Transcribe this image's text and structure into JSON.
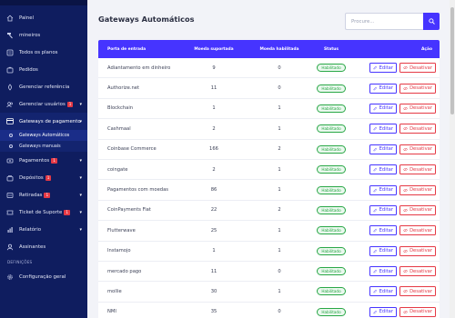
{
  "sidebar": {
    "items": [
      {
        "label": "Painel",
        "icon": "home-icon"
      },
      {
        "label": "mineiros",
        "icon": "hammer-icon"
      },
      {
        "label": "Todos os planos",
        "icon": "list-icon"
      },
      {
        "label": "Pedidos",
        "icon": "cart-icon"
      },
      {
        "label": "Gerenciar referência",
        "icon": "share-icon"
      },
      {
        "label": "Gerenciar usuários",
        "icon": "users-icon",
        "badge": "1"
      }
    ],
    "group": {
      "label": "Gateways de pagamento",
      "icon": "credit-card-icon",
      "children": [
        {
          "label": "Gateways Automáticos",
          "active": true
        },
        {
          "label": "Gateways manuais"
        }
      ]
    },
    "items2": [
      {
        "label": "Pagamentos",
        "icon": "payments-icon",
        "badge": "1"
      },
      {
        "label": "Depósitos",
        "icon": "deposit-icon",
        "badge": "1"
      },
      {
        "label": "Retiradas",
        "icon": "withdraw-icon",
        "badge": "1"
      },
      {
        "label": "Ticket de Suporte",
        "icon": "ticket-icon",
        "badge": "1"
      },
      {
        "label": "Relatório",
        "icon": "report-icon"
      },
      {
        "label": "Assinantes",
        "icon": "subscribers-icon"
      }
    ],
    "section": "DEFINIÇÕES",
    "items3": [
      {
        "label": "Configuração geral",
        "icon": "gear-icon"
      }
    ]
  },
  "header": {
    "title": "Gateways Automáticos",
    "search_placeholder": "Procure..."
  },
  "table": {
    "columns": [
      "Porta de entrada",
      "Moeda suportada",
      "Moeda habilitada",
      "Status",
      "Ação"
    ],
    "edit_label": "Editar",
    "disable_label": "Desativar",
    "rows": [
      {
        "name": "Adiantamento em dinheiro",
        "supported": "9",
        "enabled": "0",
        "status": "Habilitado"
      },
      {
        "name": "Authorize.net",
        "supported": "11",
        "enabled": "0",
        "status": "Habilitado"
      },
      {
        "name": "Blockchain",
        "supported": "1",
        "enabled": "1",
        "status": "Habilitado"
      },
      {
        "name": "Cashmaal",
        "supported": "2",
        "enabled": "1",
        "status": "Habilitado"
      },
      {
        "name": "Coinbase Commerce",
        "supported": "166",
        "enabled": "2",
        "status": "Habilitado"
      },
      {
        "name": "coingate",
        "supported": "2",
        "enabled": "1",
        "status": "Habilitado"
      },
      {
        "name": "Pagamentos com moedas",
        "supported": "86",
        "enabled": "1",
        "status": "Habilitado"
      },
      {
        "name": "CoinPayments Fiat",
        "supported": "22",
        "enabled": "2",
        "status": "Habilitado"
      },
      {
        "name": "Flutterwave",
        "supported": "25",
        "enabled": "1",
        "status": "Habilitado"
      },
      {
        "name": "Instamojo",
        "supported": "1",
        "enabled": "1",
        "status": "Habilitado"
      },
      {
        "name": "mercado pago",
        "supported": "11",
        "enabled": "0",
        "status": "Habilitado"
      },
      {
        "name": "mollie",
        "supported": "30",
        "enabled": "1",
        "status": "Habilitado"
      },
      {
        "name": "NMI",
        "supported": "35",
        "enabled": "0",
        "status": "Habilitado"
      }
    ]
  },
  "colors": {
    "sidebar": "#0f1d5f",
    "accent": "#4634ff",
    "success": "#28a745",
    "danger": "#e53945"
  }
}
